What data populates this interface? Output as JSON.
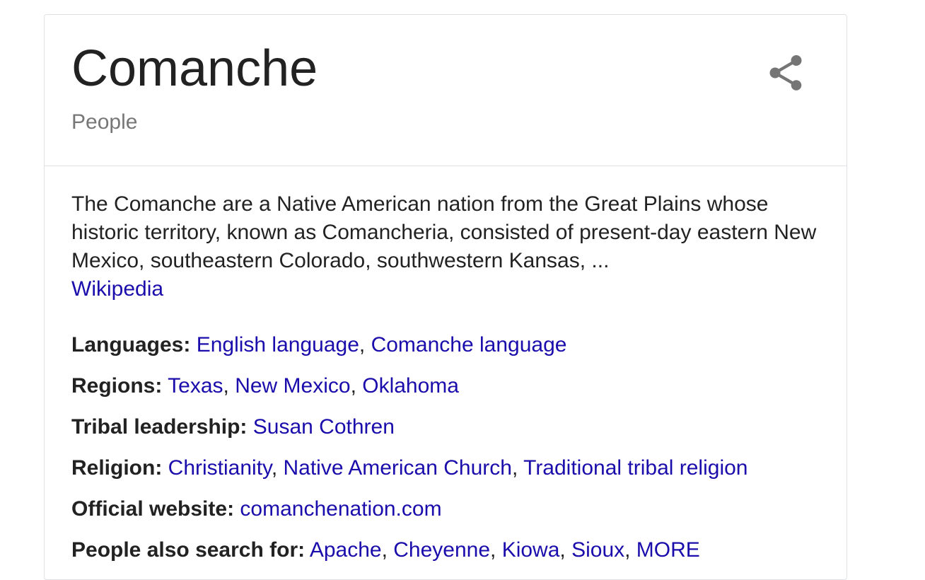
{
  "panel": {
    "title": "Comanche",
    "subtitle": "People",
    "share_icon": "share-icon",
    "description": "The Comanche are a Native American nation from the Great Plains whose historic territory, known as Comancheria, consisted of present-day eastern New Mexico, southeastern Colorado, southwestern Kansas, ...",
    "source_link": "Wikipedia"
  },
  "facts": [
    {
      "label": "Languages:",
      "name": "languages",
      "links": [
        "English language",
        "Comanche language"
      ]
    },
    {
      "label": "Regions:",
      "name": "regions",
      "links": [
        "Texas",
        "New Mexico",
        "Oklahoma"
      ]
    },
    {
      "label": "Tribal leadership:",
      "name": "tribal-leadership",
      "links": [
        "Susan Cothren"
      ]
    },
    {
      "label": "Religion:",
      "name": "religion",
      "links": [
        "Christianity",
        "Native American Church",
        "Traditional tribal religion"
      ]
    },
    {
      "label": "Official website:",
      "name": "official-website",
      "links": [
        "comanchenation.com"
      ]
    },
    {
      "label": "People also search for:",
      "name": "people-also-search-for",
      "links": [
        "Apache",
        "Cheyenne",
        "Kiowa",
        "Sioux",
        "MORE"
      ]
    }
  ],
  "colors": {
    "link": "#1a0dab",
    "text": "#222222",
    "subtitle": "#777777",
    "icon": "#757575"
  }
}
